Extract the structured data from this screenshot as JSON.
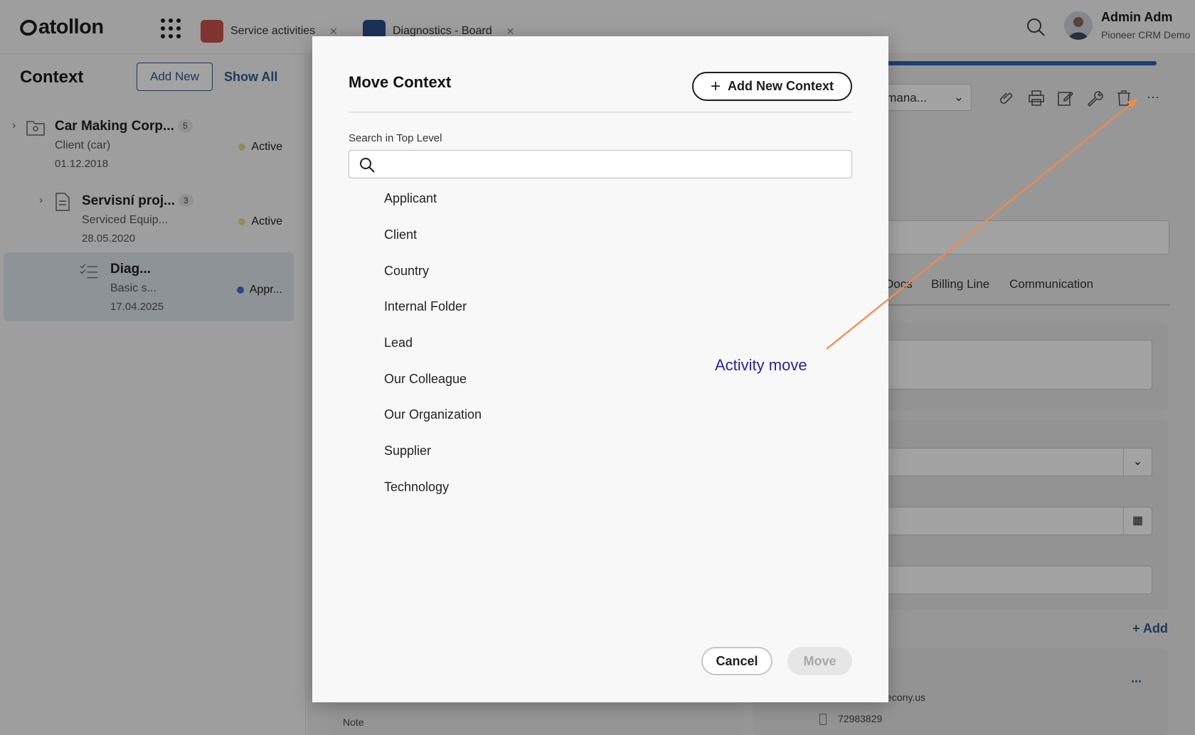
{
  "header": {
    "logo": "atollon",
    "tabs": [
      {
        "label": "Service activities",
        "icon": "activities-icon",
        "color": "#c9524a"
      },
      {
        "label": "Diagnostics - Board",
        "icon": "board-icon",
        "color": "#2b4f8c"
      }
    ],
    "user": {
      "name": "Admin Adm",
      "org": "Pioneer CRM Demo"
    }
  },
  "sidebar": {
    "title": "Context",
    "add_new_label": "Add New",
    "show_all_label": "Show All",
    "items": [
      {
        "name": "Car Making Corp...",
        "count": "5",
        "sub": "Client (car)",
        "date": "01.12.2018",
        "status": "Active",
        "status_color": "#e8d98a"
      },
      {
        "name": "Servisní proj...",
        "count": "3",
        "sub": "Serviced Equip...",
        "date": "28.05.2020",
        "status": "Active",
        "status_color": "#e8d98a"
      },
      {
        "name": "Diag...",
        "count": "",
        "sub": "Basic s...",
        "date": "17.04.2025",
        "status": "Appr...",
        "status_color": "#3a6fd1"
      }
    ]
  },
  "main": {
    "view_select": "y mana...",
    "tabs": [
      "Docs",
      "Billing Line",
      "Communication"
    ],
    "add_label": "Add",
    "note_label": "Note",
    "contact_email": "econy.us",
    "contact_phone": "72983829",
    "more_label": "..."
  },
  "modal": {
    "title": "Move Context",
    "add_context_label": "Add New Context",
    "search_label": "Search in Top Level",
    "search_value": "",
    "context_types": [
      "Applicant",
      "Client",
      "Country",
      "Internal Folder",
      "Lead",
      "Our Colleague",
      "Our Organization",
      "Supplier",
      "Technology"
    ],
    "cancel_label": "Cancel",
    "move_label": "Move"
  },
  "annotation": {
    "text": "Activity move",
    "color": "#f08a4b"
  }
}
